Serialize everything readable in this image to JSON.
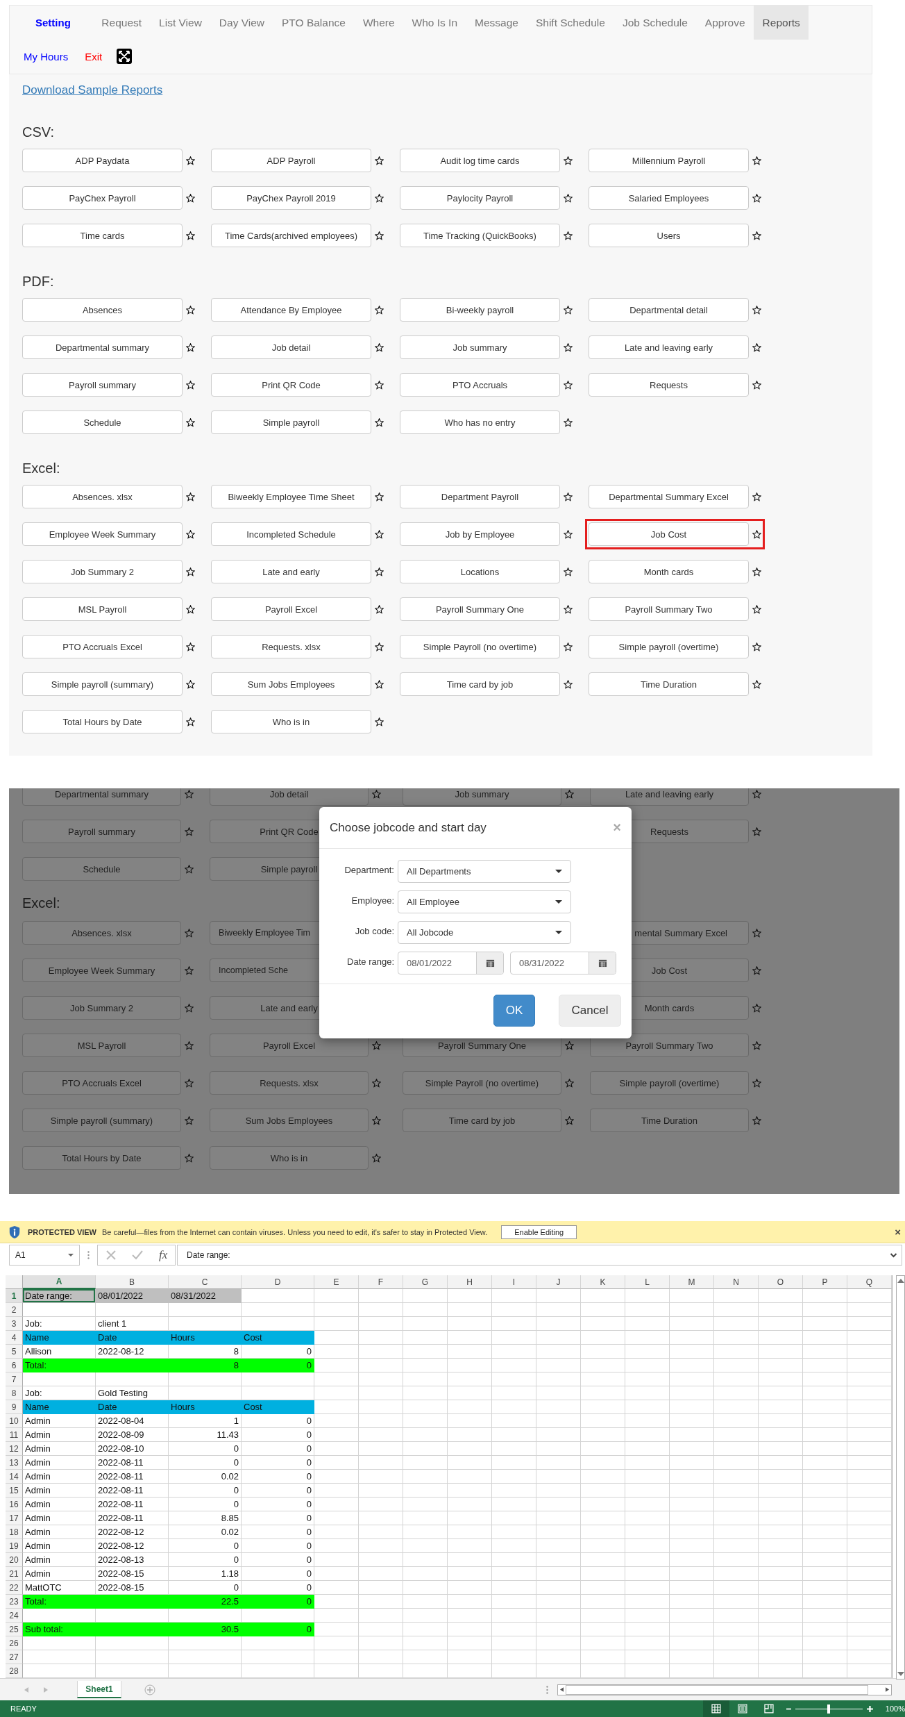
{
  "nav": {
    "brand": "Setting",
    "tabs": [
      {
        "label": "Request",
        "selected": false
      },
      {
        "label": "List View",
        "selected": false
      },
      {
        "label": "Day View",
        "selected": false
      },
      {
        "label": "PTO Balance",
        "selected": false
      },
      {
        "label": "Where",
        "selected": false
      },
      {
        "label": "Who Is In",
        "selected": false
      },
      {
        "label": "Message",
        "selected": false
      },
      {
        "label": "Shift Schedule",
        "selected": false
      },
      {
        "label": "Job Schedule",
        "selected": false
      },
      {
        "label": "Approve",
        "selected": false
      },
      {
        "label": "Reports",
        "selected": true
      }
    ],
    "links": [
      {
        "label": "My Hours",
        "color": "#0000ff"
      },
      {
        "label": "Exit",
        "color": "#ff0000"
      }
    ]
  },
  "download_link": "Download Sample Reports",
  "sections": [
    {
      "title": "CSV:",
      "reports": [
        {
          "label": "ADP Paydata",
          "highlighted": false
        },
        {
          "label": "ADP Payroll",
          "highlighted": false
        },
        {
          "label": "Audit log time cards",
          "highlighted": false
        },
        {
          "label": "Millennium Payroll",
          "highlighted": false
        },
        {
          "label": "PayChex Payroll",
          "highlighted": false
        },
        {
          "label": "PayChex Payroll 2019",
          "highlighted": false
        },
        {
          "label": "Paylocity Payroll",
          "highlighted": false
        },
        {
          "label": "Salaried Employees",
          "highlighted": false
        },
        {
          "label": "Time cards",
          "highlighted": false
        },
        {
          "label": "Time Cards(archived employees)",
          "highlighted": false
        },
        {
          "label": "Time Tracking (QuickBooks)",
          "highlighted": false
        },
        {
          "label": "Users",
          "highlighted": false
        }
      ]
    },
    {
      "title": "PDF:",
      "reports": [
        {
          "label": "Absences",
          "highlighted": false
        },
        {
          "label": "Attendance By Employee",
          "highlighted": false
        },
        {
          "label": "Bi-weekly payroll",
          "highlighted": false
        },
        {
          "label": "Departmental detail",
          "highlighted": false
        },
        {
          "label": "Departmental summary",
          "highlighted": false
        },
        {
          "label": "Job detail",
          "highlighted": false
        },
        {
          "label": "Job summary",
          "highlighted": false
        },
        {
          "label": "Late and leaving early",
          "highlighted": false
        },
        {
          "label": "Payroll summary",
          "highlighted": false
        },
        {
          "label": "Print QR Code",
          "highlighted": false
        },
        {
          "label": "PTO Accruals",
          "highlighted": false
        },
        {
          "label": "Requests",
          "highlighted": false
        },
        {
          "label": "Schedule",
          "highlighted": false
        },
        {
          "label": "Simple payroll",
          "highlighted": false
        },
        {
          "label": "Who has no entry",
          "highlighted": false
        }
      ]
    },
    {
      "title": "Excel:",
      "reports": [
        {
          "label": "Absences. xlsx",
          "highlighted": false
        },
        {
          "label": "Biweekly Employee Time Sheet",
          "highlighted": false
        },
        {
          "label": "Department Payroll",
          "highlighted": false
        },
        {
          "label": "Departmental Summary Excel",
          "highlighted": false
        },
        {
          "label": "Employee Week Summary",
          "highlighted": false
        },
        {
          "label": "Incompleted Schedule",
          "highlighted": false
        },
        {
          "label": "Job by Employee",
          "highlighted": false
        },
        {
          "label": "Job Cost",
          "highlighted": true
        },
        {
          "label": "Job Summary 2",
          "highlighted": false
        },
        {
          "label": "Late and early",
          "highlighted": false
        },
        {
          "label": "Locations",
          "highlighted": false
        },
        {
          "label": "Month cards",
          "highlighted": false
        },
        {
          "label": "MSL Payroll",
          "highlighted": false
        },
        {
          "label": "Payroll Excel",
          "highlighted": false
        },
        {
          "label": "Payroll Summary One",
          "highlighted": false
        },
        {
          "label": "Payroll Summary Two",
          "highlighted": false
        },
        {
          "label": "PTO Accruals Excel",
          "highlighted": false
        },
        {
          "label": "Requests. xlsx",
          "highlighted": false
        },
        {
          "label": "Simple Payroll (no overtime)",
          "highlighted": false
        },
        {
          "label": "Simple payroll (overtime)",
          "highlighted": false
        },
        {
          "label": "Simple payroll (summary)",
          "highlighted": false
        },
        {
          "label": "Sum Jobs Employees",
          "highlighted": false
        },
        {
          "label": "Time card by job",
          "highlighted": false
        },
        {
          "label": "Time Duration",
          "highlighted": false
        },
        {
          "label": "Total Hours by Date",
          "highlighted": false
        },
        {
          "label": "Who is in",
          "highlighted": false
        }
      ]
    }
  ],
  "dimmed_view": {
    "items": [
      {
        "kind": "row",
        "left": [
          {
            "kind": "button",
            "label": "Departmental summary"
          },
          {
            "kind": "button",
            "label": "Job detail"
          }
        ],
        "right": [
          {
            "kind": "button",
            "label": "Job summary"
          },
          {
            "kind": "button",
            "label": "Late and leaving early"
          }
        ]
      },
      {
        "kind": "covered_row",
        "left": [
          {
            "kind": "button",
            "label": "Payroll summary"
          },
          {
            "kind": "button",
            "label": "Print QR Code"
          }
        ],
        "right": [
          {
            "kind": "button",
            "label": "Requests"
          }
        ]
      },
      {
        "kind": "covered_row",
        "left": [
          {
            "kind": "button",
            "label": "Schedule"
          },
          {
            "kind": "button",
            "label": "Simple payroll"
          }
        ]
      },
      {
        "kind": "heading",
        "title": "Excel:"
      },
      {
        "kind": "covered_row",
        "left": [
          {
            "kind": "button",
            "label": "Absences. xlsx"
          },
          {
            "kind": "cut_end",
            "label": "Biweekly Employee Tim"
          }
        ],
        "right": [
          {
            "kind": "cut_start",
            "label": "mental Summary Excel"
          }
        ]
      },
      {
        "kind": "covered_row",
        "left": [
          {
            "kind": "button",
            "label": "Employee Week Summary"
          },
          {
            "kind": "cut_end",
            "label": "Incompleted Sche"
          }
        ],
        "right": [
          {
            "kind": "button",
            "label": "Job Cost"
          }
        ]
      },
      {
        "kind": "covered_row",
        "left": [
          {
            "kind": "button",
            "label": "Job Summary 2"
          },
          {
            "kind": "button",
            "label": "Late and early"
          }
        ],
        "right": [
          {
            "kind": "button",
            "label": "Month cards"
          }
        ]
      },
      {
        "kind": "row",
        "left": [
          {
            "kind": "button",
            "label": "MSL Payroll"
          },
          {
            "kind": "button",
            "label": "Payroll Excel"
          }
        ],
        "right": [
          {
            "kind": "button",
            "label": "Payroll Summary One"
          },
          {
            "kind": "button",
            "label": "Payroll Summary Two"
          }
        ]
      },
      {
        "kind": "row",
        "left": [
          {
            "kind": "button",
            "label": "PTO Accruals Excel"
          },
          {
            "kind": "button",
            "label": "Requests. xlsx"
          }
        ],
        "right": [
          {
            "kind": "button",
            "label": "Simple Payroll (no overtime)"
          },
          {
            "kind": "button",
            "label": "Simple payroll (overtime)"
          }
        ]
      },
      {
        "kind": "row",
        "left": [
          {
            "kind": "button",
            "label": "Simple payroll (summary)"
          },
          {
            "kind": "button",
            "label": "Sum Jobs Employees"
          }
        ],
        "right": [
          {
            "kind": "button",
            "label": "Time card by job"
          },
          {
            "kind": "button",
            "label": "Time Duration"
          }
        ]
      },
      {
        "kind": "row",
        "left": [
          {
            "kind": "button",
            "label": "Total Hours by Date"
          },
          {
            "kind": "button",
            "label": "Who is in"
          }
        ]
      }
    ]
  },
  "modal": {
    "title": "Choose jobcode and start day",
    "close": "×",
    "fields": [
      {
        "label": "Department:",
        "kind": "select",
        "value": "All Departments"
      },
      {
        "label": "Employee:",
        "kind": "select",
        "value": "All Employee"
      },
      {
        "label": "Job code:",
        "kind": "select",
        "value": "All Jobcode"
      },
      {
        "label": "Date range:",
        "kind": "dates",
        "values": [
          "08/01/2022",
          "08/31/2022"
        ]
      }
    ],
    "buttons": [
      {
        "label": "OK",
        "kind": "primary"
      },
      {
        "label": "Cancel",
        "kind": "default"
      }
    ]
  },
  "spreadsheet": {
    "protected_view": {
      "title": "PROTECTED VIEW",
      "message": "Be careful—files from the Internet can contain viruses. Unless you need to edit, it's safer to stay in Protected View.",
      "button": "Enable Editing",
      "close": "×"
    },
    "name_box": "A1",
    "function_button": "fx",
    "formula": "Date range:",
    "columns": [
      {
        "label": "A",
        "selected": true
      },
      {
        "label": "B",
        "selected": false
      },
      {
        "label": "C",
        "selected": false
      },
      {
        "label": "D",
        "selected": false
      },
      {
        "label": "E",
        "selected": false
      },
      {
        "label": "F",
        "selected": false
      },
      {
        "label": "G",
        "selected": false
      },
      {
        "label": "H",
        "selected": false
      },
      {
        "label": "I",
        "selected": false
      },
      {
        "label": "J",
        "selected": false
      },
      {
        "label": "K",
        "selected": false
      },
      {
        "label": "L",
        "selected": false
      },
      {
        "label": "M",
        "selected": false
      },
      {
        "label": "N",
        "selected": false
      },
      {
        "label": "O",
        "selected": false
      },
      {
        "label": "P",
        "selected": false
      },
      {
        "label": "Q",
        "selected": false
      }
    ],
    "rows": [
      {
        "number": "1",
        "selected": true,
        "kind": "range",
        "label": "Date range:",
        "start": "08/01/2022",
        "end": "08/31/2022"
      },
      {
        "number": "2",
        "selected": false,
        "kind": "blank"
      },
      {
        "number": "3",
        "selected": false,
        "kind": "job",
        "label": "Job:",
        "value": "client 1"
      },
      {
        "number": "4",
        "selected": false,
        "kind": "header",
        "cells": [
          "Name",
          "Date",
          "Hours",
          "Cost"
        ]
      },
      {
        "number": "5",
        "selected": false,
        "kind": "data",
        "name": "Allison",
        "date": "2022-08-12",
        "hours": "8",
        "cost": "0"
      },
      {
        "number": "6",
        "selected": false,
        "kind": "total",
        "label": "Total:",
        "hours": "8",
        "cost": "0"
      },
      {
        "number": "7",
        "selected": false,
        "kind": "blank"
      },
      {
        "number": "8",
        "selected": false,
        "kind": "job",
        "label": "Job:",
        "value": "Gold Testing"
      },
      {
        "number": "9",
        "selected": false,
        "kind": "header",
        "cells": [
          "Name",
          "Date",
          "Hours",
          "Cost"
        ]
      },
      {
        "number": "10",
        "selected": false,
        "kind": "data",
        "name": "Admin",
        "date": "2022-08-04",
        "hours": "1",
        "cost": "0"
      },
      {
        "number": "11",
        "selected": false,
        "kind": "data",
        "name": "Admin",
        "date": "2022-08-09",
        "hours": "11.43",
        "cost": "0"
      },
      {
        "number": "12",
        "selected": false,
        "kind": "data",
        "name": "Admin",
        "date": "2022-08-10",
        "hours": "0",
        "cost": "0"
      },
      {
        "number": "13",
        "selected": false,
        "kind": "data",
        "name": "Admin",
        "date": "2022-08-11",
        "hours": "0",
        "cost": "0"
      },
      {
        "number": "14",
        "selected": false,
        "kind": "data",
        "name": "Admin",
        "date": "2022-08-11",
        "hours": "0.02",
        "cost": "0"
      },
      {
        "number": "15",
        "selected": false,
        "kind": "data",
        "name": "Admin",
        "date": "2022-08-11",
        "hours": "0",
        "cost": "0"
      },
      {
        "number": "16",
        "selected": false,
        "kind": "data",
        "name": "Admin",
        "date": "2022-08-11",
        "hours": "0",
        "cost": "0"
      },
      {
        "number": "17",
        "selected": false,
        "kind": "data",
        "name": "Admin",
        "date": "2022-08-11",
        "hours": "8.85",
        "cost": "0"
      },
      {
        "number": "18",
        "selected": false,
        "kind": "data",
        "name": "Admin",
        "date": "2022-08-12",
        "hours": "0.02",
        "cost": "0"
      },
      {
        "number": "19",
        "selected": false,
        "kind": "data",
        "name": "Admin",
        "date": "2022-08-12",
        "hours": "0",
        "cost": "0"
      },
      {
        "number": "20",
        "selected": false,
        "kind": "data",
        "name": "Admin",
        "date": "2022-08-13",
        "hours": "0",
        "cost": "0"
      },
      {
        "number": "21",
        "selected": false,
        "kind": "data",
        "name": "Admin",
        "date": "2022-08-15",
        "hours": "1.18",
        "cost": "0"
      },
      {
        "number": "22",
        "selected": false,
        "kind": "data",
        "name": "MattOTC",
        "date": "2022-08-15",
        "hours": "0",
        "cost": "0"
      },
      {
        "number": "23",
        "selected": false,
        "kind": "total",
        "label": "Total:",
        "hours": "22.5",
        "cost": "0"
      },
      {
        "number": "24",
        "selected": false,
        "kind": "blank"
      },
      {
        "number": "25",
        "selected": false,
        "kind": "total",
        "label": "Sub total:",
        "hours": "30.5",
        "cost": "0"
      },
      {
        "number": "26",
        "selected": false,
        "kind": "blank"
      },
      {
        "number": "27",
        "selected": false,
        "kind": "blank"
      },
      {
        "number": "28",
        "selected": false,
        "kind": "blank"
      }
    ],
    "sheet_tabs": [
      {
        "label": "Sheet1",
        "selected": true
      }
    ],
    "status": "READY",
    "zoom_slider": {
      "level": 0.5
    },
    "zoom": "100%"
  }
}
